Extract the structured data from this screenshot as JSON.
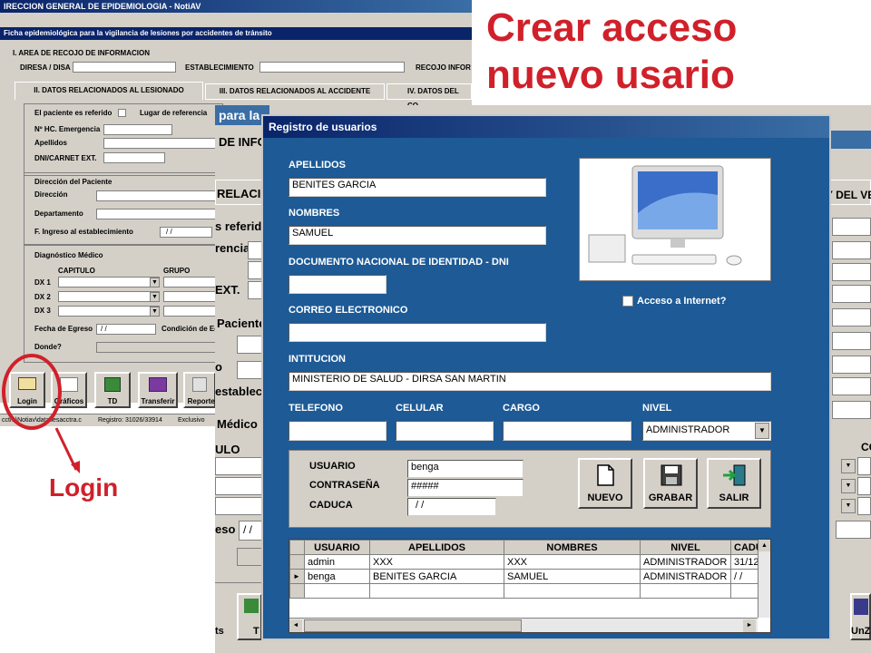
{
  "annotation": {
    "title_line1": "Crear acceso",
    "title_line2": "nuevo usario",
    "login_caption": "Login",
    "accent_color": "#d0202a"
  },
  "back_window": {
    "title": "IRECCION GENERAL DE EPIDEMIOLOGIA - NotiAV",
    "subtitle": "Ficha epidemiológica para la vigilancia de lesiones por accidentes de tránsito",
    "section1": "I. AREA DE RECOJO DE INFORMACION",
    "diresa": "DIRESA / DISA",
    "establecimiento": "ESTABLECIMIENTO",
    "recojo": "RECOJO INFOR",
    "tabs": [
      "II. DATOS RELACIONADOS AL LESIONADO",
      "III. DATOS RELACIONADOS AL ACCIDENTE",
      "IV. DATOS DEL CO"
    ],
    "referido": "El paciente es referido",
    "lugar_ref": "Lugar de referencia",
    "hc": "Nº HC. Emergencia",
    "apellidos": "Apellidos",
    "dni": "DNI/CARNET EXT.",
    "dir_paciente": "Dirección del Paciente",
    "direccion": "Dirección",
    "departamento": "Departamento",
    "f_ingreso": "F. Ingreso al establecimiento",
    "f_ingreso_val": "/ /",
    "diag": "Diagnóstico Médico",
    "capitulo": "CAPITULO",
    "grupo": "GRUPO",
    "dx": [
      "DX 1",
      "DX 2",
      "DX 3"
    ],
    "fecha_egreso": "Fecha de Egreso",
    "fecha_egreso_val": "/ /",
    "condicion": "Condición de Eg",
    "donde": "Donde?",
    "toolbar": [
      "Login",
      "Gráficos",
      "TD",
      "Transferir",
      "Reportes"
    ],
    "status_path": "cctra\\Notiav\\data\\lesacctra.c",
    "status_reg": "Registro: 31026/33914",
    "status_mode": "Exclusivo"
  },
  "middle_window": {
    "frag_para": "para la",
    "frag_infor": "DE INFOR",
    "frag_relacionad": "RELACIONAD",
    "frag_referido": "s referido",
    "frag_encia": "rencia",
    "frag_ext": "EXT.",
    "frag_paciente": "Paciente",
    "frag_o": "o",
    "frag_establec": "establecin",
    "frag_medico": "Médico",
    "frag_ulo": "ULO",
    "frag_eso": "eso",
    "frag_eso_val": "/ /",
    "frag_ts": "ts",
    "frag_t": "T",
    "right_del_ve": "Y DEL VE",
    "right_co": "CO",
    "right_btn": "UnZ"
  },
  "dialog": {
    "title": "Registro de usuarios",
    "apellidos_label": "APELLIDOS",
    "apellidos_value": "BENITES GARCIA",
    "nombres_label": "NOMBRES",
    "nombres_value": "SAMUEL",
    "dni_label": "DOCUMENTO NACIONAL DE IDENTIDAD - DNI",
    "dni_value": "",
    "correo_label": "CORREO ELECTRONICO",
    "correo_value": "",
    "institucion_label": "INTITUCION",
    "institucion_value": "MINISTERIO DE SALUD - DIRSA SAN MARTIN",
    "telefono_label": "TELEFONO",
    "celular_label": "CELULAR",
    "cargo_label": "CARGO",
    "nivel_label": "NIVEL",
    "nivel_value": "ADMINISTRADOR",
    "internet_label": "Acceso a Internet?",
    "usuario_label": "USUARIO",
    "usuario_value": "benga",
    "contrasena_label": "CONTRASEÑA",
    "contrasena_value": "#####",
    "caduca_label": "CADUCA",
    "caduca_value": "/ /",
    "btn_nuevo": "NUEVO",
    "btn_grabar": "GRABAR",
    "btn_salir": "SALIR",
    "grid_headers": [
      "USUARIO",
      "APELLIDOS",
      "NOMBRES",
      "NIVEL",
      "CADU"
    ],
    "grid_rows": [
      [
        "admin",
        "XXX",
        "XXX",
        "ADMINISTRADOR",
        "31/12"
      ],
      [
        "benga",
        "BENITES GARCIA",
        "SAMUEL",
        "ADMINISTRADOR",
        "/ /"
      ]
    ]
  }
}
